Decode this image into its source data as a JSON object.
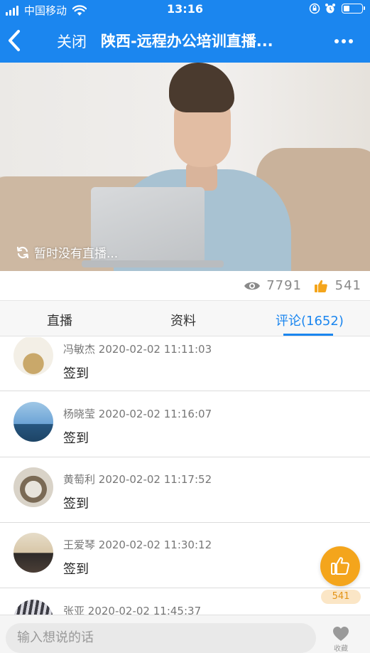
{
  "status_bar": {
    "carrier": "中国移动",
    "time": "13:16"
  },
  "nav": {
    "close_label": "关闭",
    "title": "陕西-远程办公培训直播..."
  },
  "video": {
    "status_text": "暂时没有直播..."
  },
  "stats": {
    "views": "7791",
    "likes": "541"
  },
  "tabs": [
    {
      "label": "直播",
      "active": false
    },
    {
      "label": "资料",
      "active": false
    },
    {
      "label": "评论(1652)",
      "active": true
    }
  ],
  "comments": [
    {
      "name": "冯敏杰",
      "time": "2020-02-02 11:11:03",
      "text": "签到"
    },
    {
      "name": "杨晓莹",
      "time": "2020-02-02 11:16:07",
      "text": "签到"
    },
    {
      "name": "黄萄利",
      "time": "2020-02-02 11:17:52",
      "text": "签到"
    },
    {
      "name": "王爱琴",
      "time": "2020-02-02 11:30:12",
      "text": "签到"
    },
    {
      "name": "张亚",
      "time": "2020-02-02 11:45:37",
      "text": ""
    }
  ],
  "float_like": {
    "count": "541"
  },
  "bottom_bar": {
    "input_placeholder": "输入想说的话",
    "favorite_label": "收藏"
  },
  "colors": {
    "primary": "#1b86ef",
    "like_orange": "#f4a51c"
  }
}
